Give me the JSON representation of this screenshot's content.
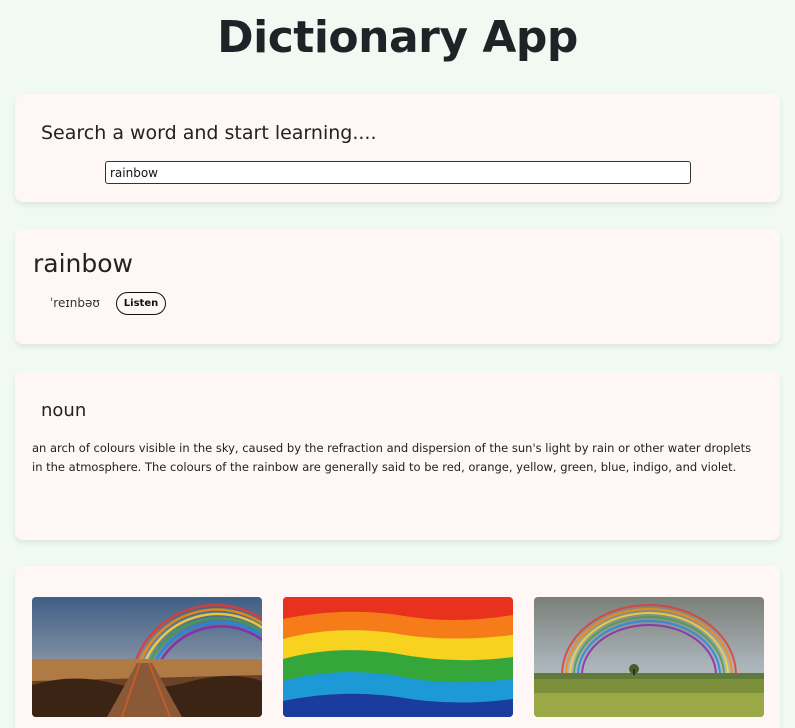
{
  "app": {
    "title": "Dictionary App"
  },
  "search": {
    "heading": "Search a word and start learning....",
    "value": "rainbow"
  },
  "entry": {
    "word": "rainbow",
    "phonetic": "ˈreɪnbəʊ",
    "listen_label": "Listen"
  },
  "meaning": {
    "part_of_speech": "noun",
    "definition": "an arch of colours visible in the sky, caused by the refraction and dispersion of the sun's light by rain or other water droplets in the atmosphere. The colours of the rainbow are generally said to be red, orange, yellow, green, blue, indigo, and violet."
  },
  "images": [
    {
      "icon": "rainbow-boardwalk-photo"
    },
    {
      "icon": "rainbow-paint-stripes-photo"
    },
    {
      "icon": "rainbow-field-photo"
    }
  ]
}
